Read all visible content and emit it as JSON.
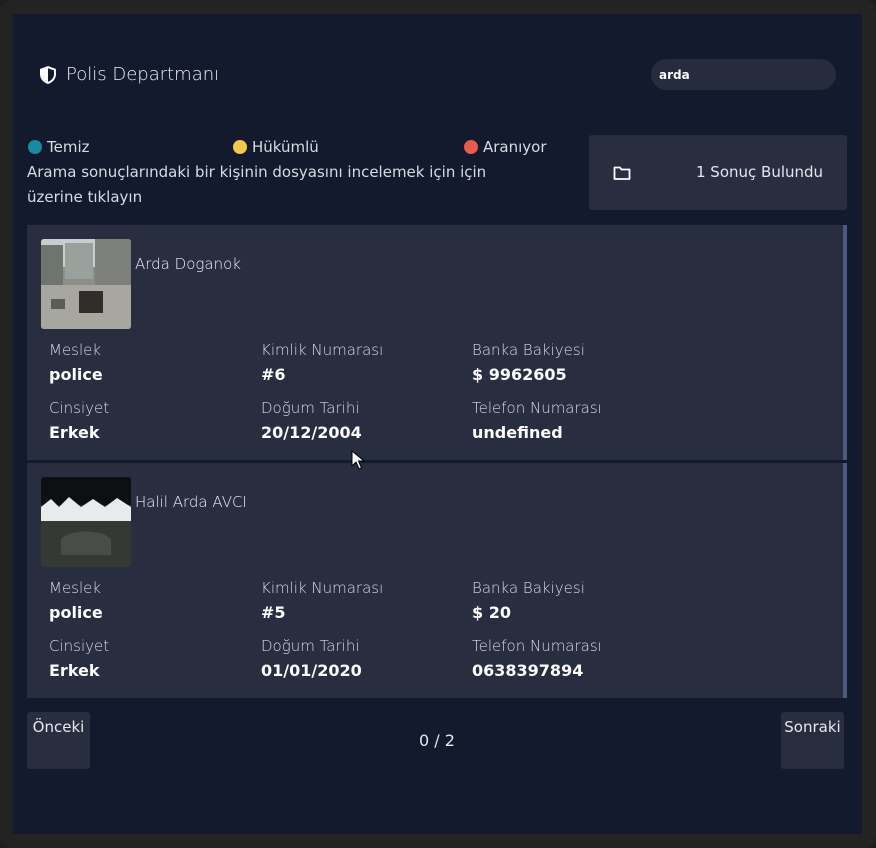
{
  "header": {
    "title": "Polis Departmanı",
    "icon": "shield-icon"
  },
  "search": {
    "value": "arda",
    "placeholder": ""
  },
  "legend": [
    {
      "label": "Temiz",
      "color": "#1a8aa0"
    },
    {
      "label": "Hükümlü",
      "color": "#f2c94c"
    },
    {
      "label": "Aranıyor",
      "color": "#eb5a4c"
    }
  ],
  "hint": "Arama sonuçlarındaki bir kişinin dosyasını incelemek için için üzerine tıklayın",
  "result_count": "1 Sonuç Bulundu",
  "labels": {
    "job": "Meslek",
    "id": "Kimlik Numarası",
    "bank": "Banka Bakiyesi",
    "gender": "Cinsiyet",
    "dob": "Doğum Tarihi",
    "phone": "Telefon Numarası"
  },
  "records": [
    {
      "name": "Arda Doganok",
      "job": "police",
      "id": "#6",
      "bank": "$ 9962605",
      "gender": "Erkek",
      "dob": "20/12/2004",
      "phone": "undefined"
    },
    {
      "name": "Halil Arda AVCI",
      "job": "police",
      "id": "#5",
      "bank": "$ 20",
      "gender": "Erkek",
      "dob": "01/01/2020",
      "phone": "0638397894"
    }
  ],
  "pagination": {
    "prev": "Önceki",
    "next": "Sonraki",
    "status": "0 / 2"
  }
}
